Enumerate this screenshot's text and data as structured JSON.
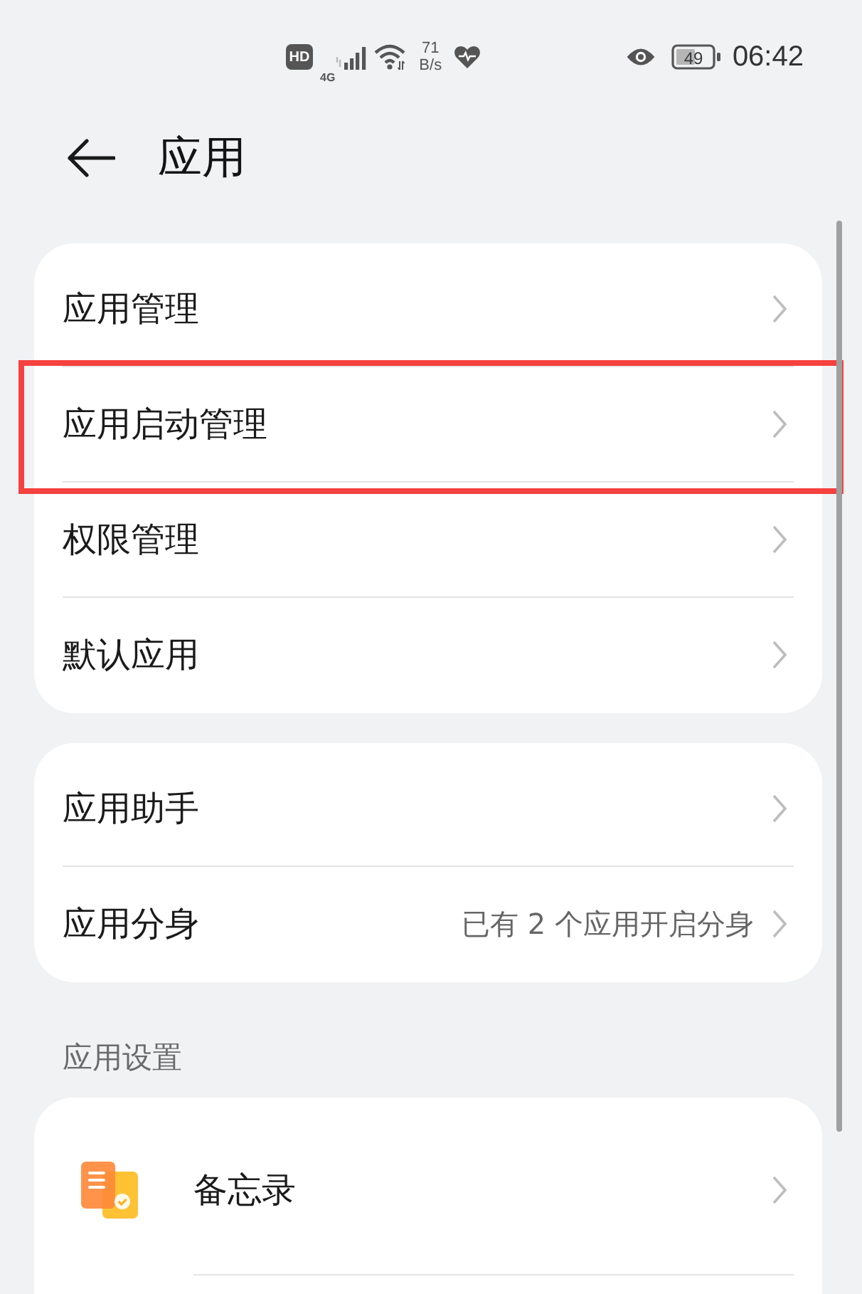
{
  "status_bar": {
    "hd_badge": "HD",
    "network_type": "4G",
    "speed_value": "71",
    "speed_unit": "B/s",
    "battery_text": "49",
    "time": "06:42"
  },
  "header": {
    "title": "应用"
  },
  "groups": [
    {
      "items": [
        {
          "label": "应用管理",
          "highlighted": false
        },
        {
          "label": "应用启动管理",
          "highlighted": true
        },
        {
          "label": "权限管理",
          "highlighted": false
        },
        {
          "label": "默认应用",
          "highlighted": false
        }
      ]
    },
    {
      "items": [
        {
          "label": "应用助手",
          "highlighted": false
        },
        {
          "label": "应用分身",
          "value": "已有 2 个应用开启分身",
          "highlighted": false
        }
      ]
    }
  ],
  "sections": [
    {
      "title": "应用设置",
      "items": [
        {
          "label": "备忘录",
          "kind": "app"
        }
      ]
    }
  ]
}
